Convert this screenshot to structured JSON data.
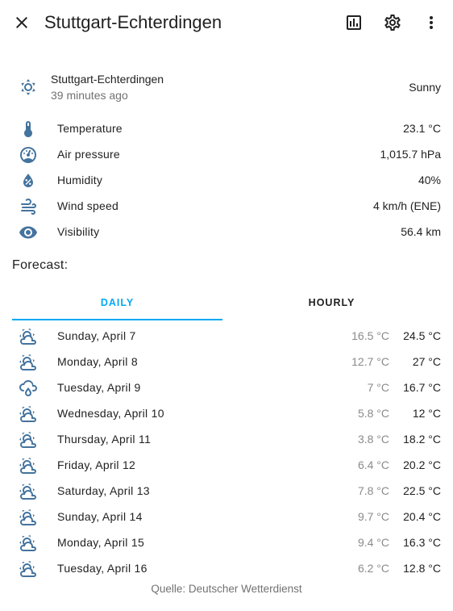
{
  "header": {
    "title": "Stuttgart-Echterdingen",
    "close_icon": "close-icon",
    "history_icon": "chart-box-icon",
    "settings_icon": "gear-icon",
    "menu_icon": "more-vert-icon"
  },
  "state": {
    "name": "Stuttgart-Echterdingen",
    "last_changed": "39 minutes ago",
    "condition": "Sunny",
    "icon": "sunny-icon"
  },
  "attributes": [
    {
      "label": "Temperature",
      "value": "23.1 °C",
      "icon": "thermometer-icon"
    },
    {
      "label": "Air pressure",
      "value": "1,015.7 hPa",
      "icon": "gauge-icon"
    },
    {
      "label": "Humidity",
      "value": "40%",
      "icon": "water-percent-icon"
    },
    {
      "label": "Wind speed",
      "value": "4 km/h (ENE)",
      "icon": "wind-icon"
    },
    {
      "label": "Visibility",
      "value": "56.4 km",
      "icon": "eye-icon"
    }
  ],
  "forecast": {
    "title": "Forecast:",
    "tabs": [
      {
        "label": "DAILY",
        "active": true
      },
      {
        "label": "HOURLY",
        "active": false
      }
    ],
    "days": [
      {
        "day": "Sunday, April 7",
        "low": "16.5 °C",
        "high": "24.5 °C",
        "icon": "partly-cloudy-icon"
      },
      {
        "day": "Monday, April 8",
        "low": "12.7 °C",
        "high": "27 °C",
        "icon": "partly-cloudy-icon"
      },
      {
        "day": "Tuesday, April 9",
        "low": "7 °C",
        "high": "16.7 °C",
        "icon": "rainy-icon"
      },
      {
        "day": "Wednesday, April 10",
        "low": "5.8 °C",
        "high": "12 °C",
        "icon": "partly-cloudy-icon"
      },
      {
        "day": "Thursday, April 11",
        "low": "3.8 °C",
        "high": "18.2 °C",
        "icon": "partly-cloudy-icon"
      },
      {
        "day": "Friday, April 12",
        "low": "6.4 °C",
        "high": "20.2 °C",
        "icon": "partly-cloudy-icon"
      },
      {
        "day": "Saturday, April 13",
        "low": "7.8 °C",
        "high": "22.5 °C",
        "icon": "partly-cloudy-icon"
      },
      {
        "day": "Sunday, April 14",
        "low": "9.7 °C",
        "high": "20.4 °C",
        "icon": "partly-cloudy-icon"
      },
      {
        "day": "Monday, April 15",
        "low": "9.4 °C",
        "high": "16.3 °C",
        "icon": "partly-cloudy-icon"
      },
      {
        "day": "Tuesday, April 16",
        "low": "6.2 °C",
        "high": "12.8 °C",
        "icon": "partly-cloudy-icon"
      }
    ]
  },
  "attribution": "Quelle: Deutscher Wetterdienst",
  "colors": {
    "accent": "#03a9f4",
    "icon": "#44739e",
    "text": "#212121",
    "secondary_text": "#727272"
  }
}
